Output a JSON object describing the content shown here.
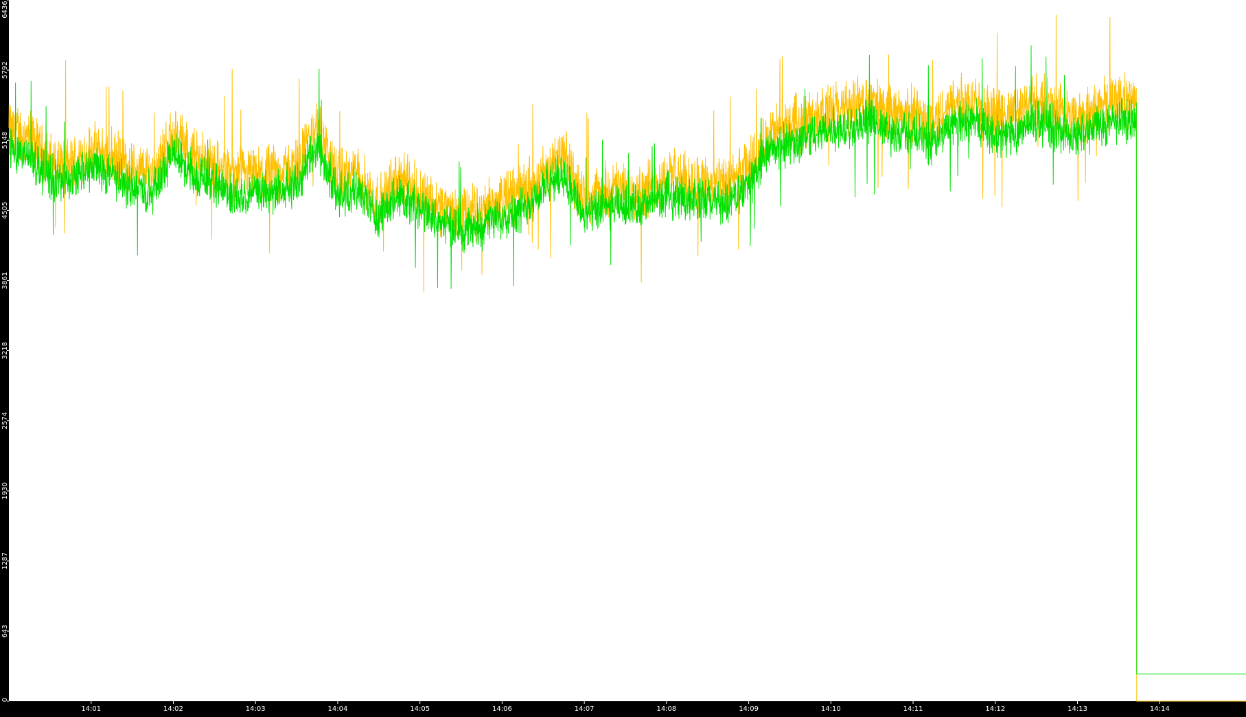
{
  "chart_data": {
    "type": "line",
    "title": "",
    "xlabel": "",
    "ylabel": "",
    "ylim": [
      0,
      6436
    ],
    "grid": false,
    "legend": "none",
    "y_ticks": [
      "0",
      "643",
      "1287",
      "1930",
      "2574",
      "3218",
      "3861",
      "4505",
      "5148",
      "5792",
      "6436"
    ],
    "x_ticks": [
      "14:01",
      "14:02",
      "14:03",
      "14:04",
      "14:05",
      "14:06",
      "14:07",
      "14:08",
      "14:09",
      "14:10",
      "14:11",
      "14:12",
      "14:13",
      "14:14"
    ],
    "x_domain_minutes": [
      0,
      15.05
    ],
    "series": [
      {
        "color": "#ffc000",
        "x_minutes": [
          0.0,
          0.25,
          0.5,
          0.75,
          1.0,
          1.25,
          1.5,
          1.75,
          2.0,
          2.25,
          2.5,
          2.75,
          3.0,
          3.25,
          3.5,
          3.75,
          4.0,
          4.25,
          4.5,
          4.75,
          5.0,
          5.25,
          5.5,
          5.75,
          6.0,
          6.25,
          6.5,
          6.75,
          7.0,
          7.25,
          7.5,
          7.75,
          8.0,
          8.25,
          8.5,
          8.75,
          9.0,
          9.25,
          9.5,
          9.75,
          10.0,
          10.25,
          10.5,
          10.75,
          11.0,
          11.25,
          11.5,
          11.75,
          12.0,
          12.25,
          12.5,
          12.75,
          13.0,
          13.25,
          13.5,
          13.72,
          13.74,
          15.05
        ],
        "values": [
          5250,
          5180,
          4950,
          4920,
          5050,
          5000,
          4880,
          4850,
          5200,
          5020,
          4900,
          4820,
          4820,
          4850,
          4900,
          5300,
          4800,
          4840,
          4550,
          4820,
          4680,
          4540,
          4460,
          4500,
          4600,
          4680,
          4850,
          5000,
          4600,
          4680,
          4700,
          4700,
          4820,
          4780,
          4760,
          4720,
          4900,
          5200,
          5280,
          5350,
          5420,
          5450,
          5500,
          5380,
          5400,
          5300,
          5500,
          5520,
          5350,
          5400,
          5520,
          5420,
          5350,
          5460,
          5520,
          5500,
          0,
          0
        ]
      },
      {
        "color": "#00e000",
        "x_minutes": [
          0.0,
          0.25,
          0.5,
          0.75,
          1.0,
          1.25,
          1.5,
          1.75,
          2.0,
          2.25,
          2.5,
          2.75,
          3.0,
          3.25,
          3.5,
          3.75,
          4.0,
          4.25,
          4.5,
          4.75,
          5.0,
          5.25,
          5.5,
          5.75,
          6.0,
          6.25,
          6.5,
          6.75,
          7.0,
          7.25,
          7.5,
          7.75,
          8.0,
          8.25,
          8.5,
          8.75,
          9.0,
          9.25,
          9.5,
          9.75,
          10.0,
          10.25,
          10.5,
          10.75,
          11.0,
          11.25,
          11.5,
          11.75,
          12.0,
          12.25,
          12.5,
          12.75,
          13.0,
          13.25,
          13.5,
          13.72,
          13.74,
          15.05
        ],
        "values": [
          5100,
          5000,
          4800,
          4780,
          4900,
          4850,
          4700,
          4680,
          5050,
          4850,
          4750,
          4650,
          4650,
          4680,
          4750,
          5100,
          4650,
          4680,
          4450,
          4650,
          4520,
          4400,
          4320,
          4360,
          4450,
          4520,
          4700,
          4850,
          4450,
          4520,
          4550,
          4550,
          4650,
          4620,
          4600,
          4560,
          4750,
          5050,
          5120,
          5180,
          5250,
          5280,
          5320,
          5200,
          5220,
          5120,
          5320,
          5340,
          5180,
          5220,
          5340,
          5240,
          5180,
          5280,
          5340,
          5320,
          250,
          250
        ]
      }
    ]
  }
}
